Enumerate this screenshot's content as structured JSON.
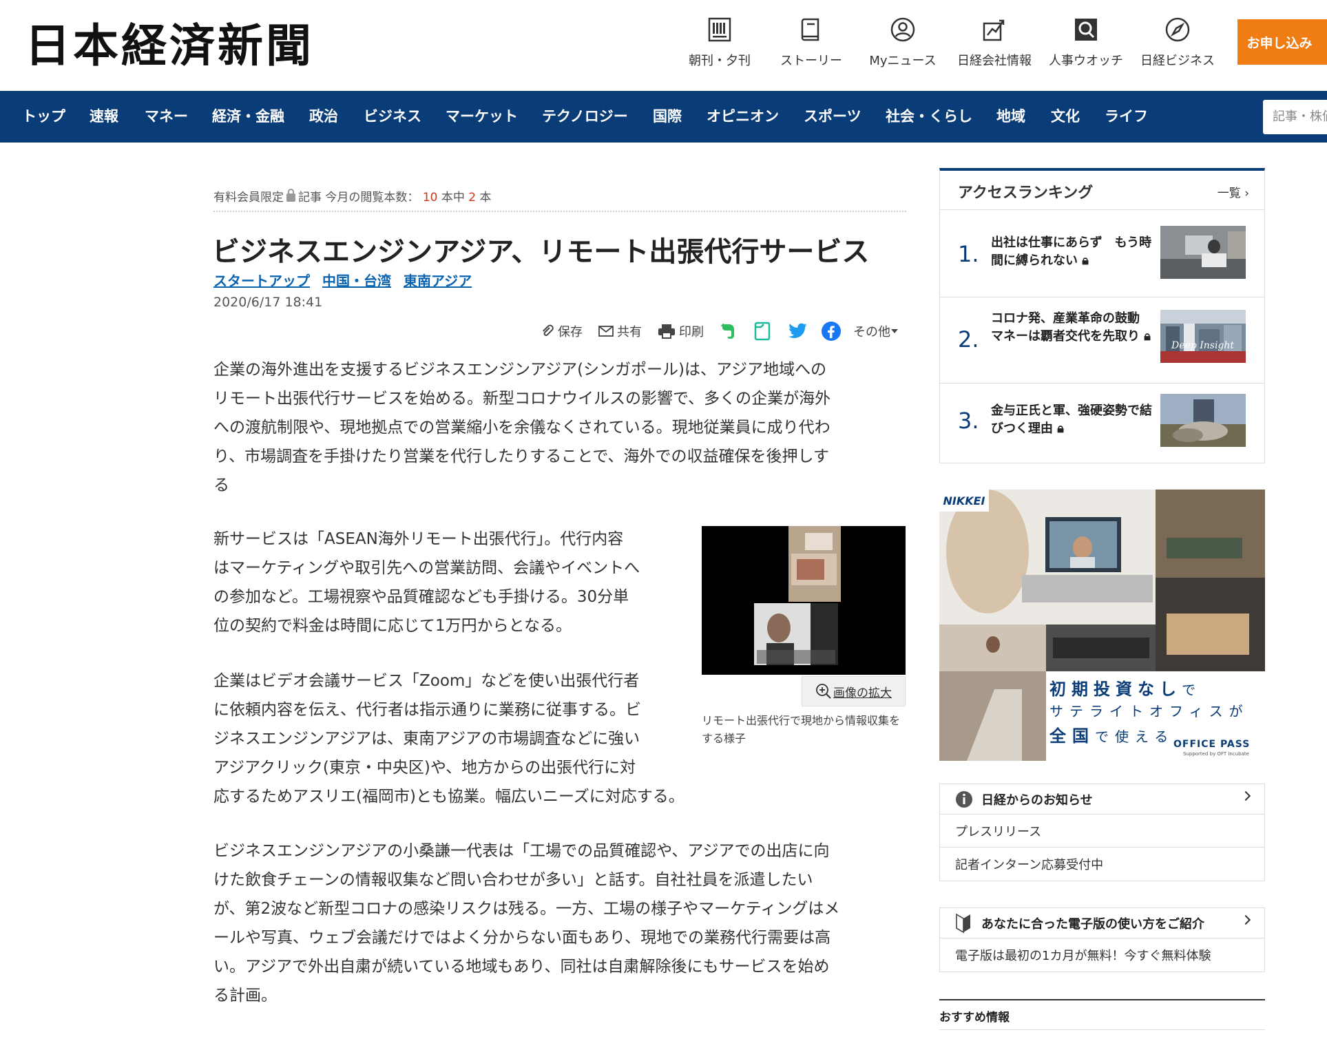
{
  "header": {
    "logo": "日本経済新聞",
    "nav": [
      {
        "label": "朝刊・夕刊",
        "icon": "newspaper-icon"
      },
      {
        "label": "ストーリー",
        "icon": "book-icon"
      },
      {
        "label": "Myニュース",
        "icon": "user-circle-icon"
      },
      {
        "label": "日経会社情報",
        "icon": "chart-icon"
      },
      {
        "label": "人事ウオッチ",
        "icon": "search-person-icon"
      },
      {
        "label": "日経ビジネス",
        "icon": "compass-icon"
      }
    ],
    "apply_label": "お申し込み"
  },
  "nav": {
    "items": [
      "トップ",
      "速報",
      "マネー",
      "経済・金融",
      "政治",
      "ビジネス",
      "マーケット",
      "テクノロジー",
      "国際",
      "オピニオン",
      "スポーツ",
      "社会・くらし",
      "地域",
      "文化",
      "ライフ"
    ],
    "search_placeholder": "記事・株価"
  },
  "article": {
    "meta_prefix": "有料会員限定",
    "meta_article": "記事",
    "meta_count_label": "今月の閲覧本数：",
    "meta_total": "10",
    "meta_middle": "本中",
    "meta_read": "2",
    "meta_suffix": "本",
    "title": "ビジネスエンジンアジア、リモート出張代行サービス",
    "topics": [
      "スタートアップ",
      "中国・台湾",
      "東南アジア"
    ],
    "date": "2020/6/17 18:41",
    "tools": {
      "save": "保存",
      "share": "共有",
      "print": "印刷",
      "more": "その他"
    },
    "paragraphs": [
      [
        "企業の海外進出を支援するビジネスエンジンアジア(シンガポール)は、アジア地域への",
        "リモート出張代行サービスを始める。新型コロナウイルスの影響で、多くの企業が海外",
        "への渡航制限や、現地拠点での営業縮小を余儀なくされている。現地従業員に成り代わ",
        "り、市場調査を手掛けたり営業を代行したりすることで、海外での収益確保を後押しす",
        "る"
      ],
      [
        "新サービスは「ASEAN海外リモート出張代行」。代行内容",
        "はマーケティングや取引先への営業訪問、会議やイベントへ",
        "の参加など。工場視察や品質確認なども手掛ける。30分単",
        "位の契約で料金は時間に応じて1万円からとなる。"
      ],
      [
        "企業はビデオ会議サービス「Zoom」などを使い出張代行者",
        "に依頼内容を伝え、代行者は指示通りに業務に従事する。ビ",
        "ジネスエンジンアジアは、東南アジアの市場調査などに強い",
        "アジアクリック(東京・中央区)や、地方からの出張代行に対",
        "応するためアスリエ(福岡市)とも協業。幅広いニーズに対応する。"
      ],
      [
        "ビジネスエンジンアジアの小桑謙一代表は「工場での品質確認や、アジアでの出店に向",
        "けた飲食チェーンの情報収集など問い合わせが多い」と話す。自社社員を派遣したい",
        "が、第2波など新型コロナの感染リスクは残る。一方、工場の様子やマーケティングはメ",
        "ールや写真、ウェブ会議だけではよく分からない面もあり、現地での業務代行需要は高",
        "い。アジアで外出自粛が続いている地域もあり、同社は自粛解除後にもサービスを始め",
        "る計画。"
      ]
    ],
    "zoom_label": "画像の拡大",
    "caption": "リモート出張代行で現地から情報収集をする様子"
  },
  "sidebar": {
    "ranking_title": "アクセスランキング",
    "ranking_more": "一覧",
    "ranking": [
      {
        "num": "1.",
        "text": "出社は仕事にあらず　もう時間に縛られない"
      },
      {
        "num": "2.",
        "text": "コロナ発、産業革命の鼓動　マネーは覇者交代を先取り",
        "badge": "Deep Insight"
      },
      {
        "num": "3.",
        "text": "金与正氏と軍、強硬姿勢で結びつく理由"
      }
    ],
    "ad": {
      "brand": "NIKKEI",
      "headline_1": "初期投資なし",
      "headline_1b": "で",
      "headline_2": "サテライトオフィス",
      "headline_2b": "が",
      "headline_3": "全国",
      "headline_3b": "で使える",
      "logo": "OFFICE PASS",
      "logo_sub": "Supported by OFT Incubate"
    },
    "notice_title": "日経からのお知らせ",
    "notices": [
      "プレスリリース",
      "記者インターン応募受付中"
    ],
    "digital_title": "あなたに合った電子版の使い方をご紹介",
    "digital_text": "電子版は最初の1カ月が無料！今すぐ無料体験",
    "recommend_title": "おすすめ情報"
  },
  "colors": {
    "nav_bg": "#0a3c78",
    "accent": "#ef7d14",
    "link": "#0a63b0",
    "alert_red": "#d2341a"
  }
}
